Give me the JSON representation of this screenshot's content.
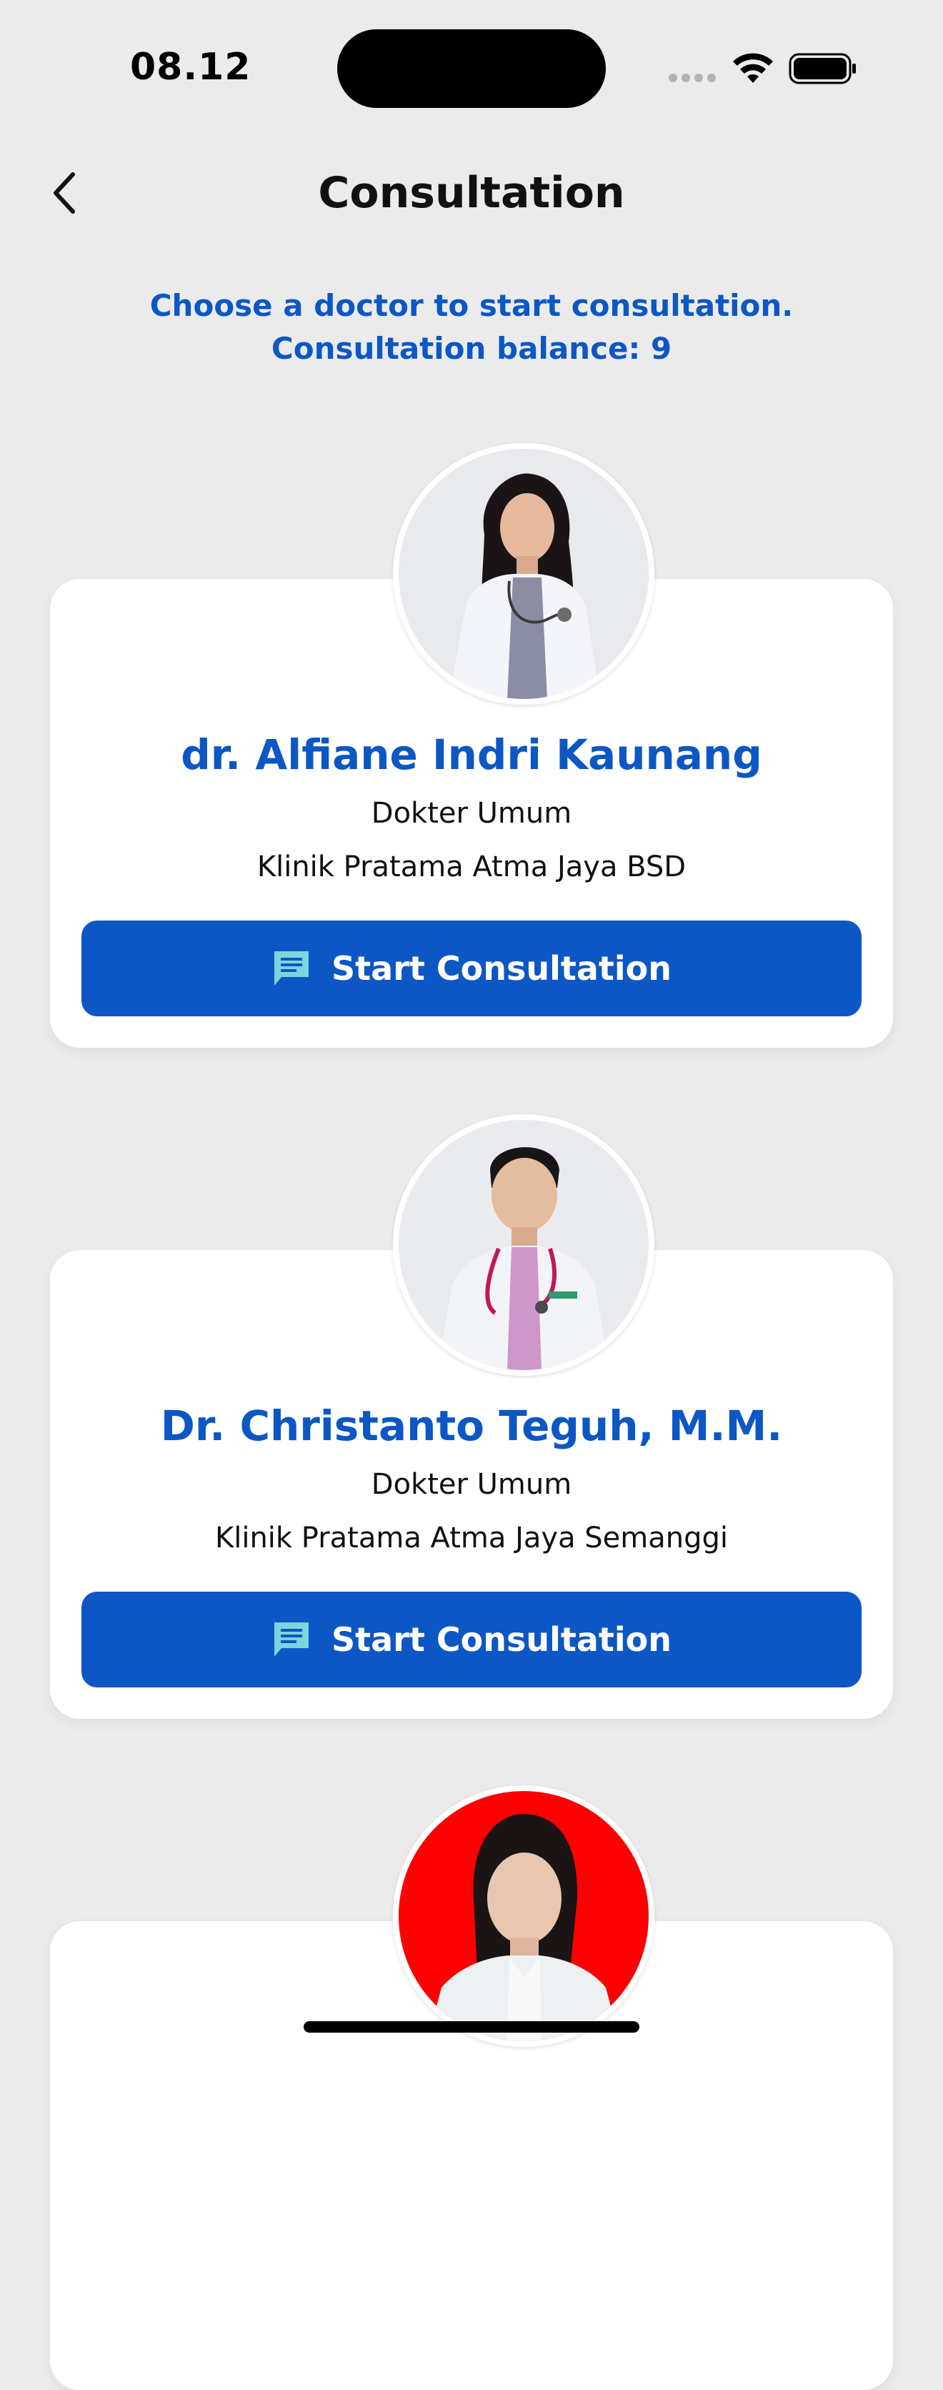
{
  "status_bar": {
    "time": "08.12",
    "icons": [
      "signal-dots-icon",
      "wifi-icon",
      "battery-icon"
    ]
  },
  "header": {
    "title": "Consultation",
    "back_icon": "chevron-left-icon"
  },
  "intro": {
    "line1": "Choose a doctor to start consultation.",
    "line2": "Consultation balance: 9"
  },
  "doctors": [
    {
      "name": "dr. Alfiane Indri Kaunang",
      "specialty": "Dokter Umum",
      "clinic": "Klinik Pratama Atma Jaya BSD",
      "button_label": "Start Consultation"
    },
    {
      "name": "Dr. Christanto Teguh, M.M.",
      "specialty": "Dokter Umum",
      "clinic": "Klinik Pratama Atma Jaya Semanggi",
      "button_label": "Start Consultation"
    },
    {
      "name": "",
      "specialty": "",
      "clinic": "",
      "button_label": ""
    }
  ],
  "colors": {
    "accent": "#0c57c4",
    "background": "#ebebeb",
    "card": "#ffffff",
    "chat_icon": "#7fd3dc",
    "avatar3_background": "#ff0000"
  }
}
